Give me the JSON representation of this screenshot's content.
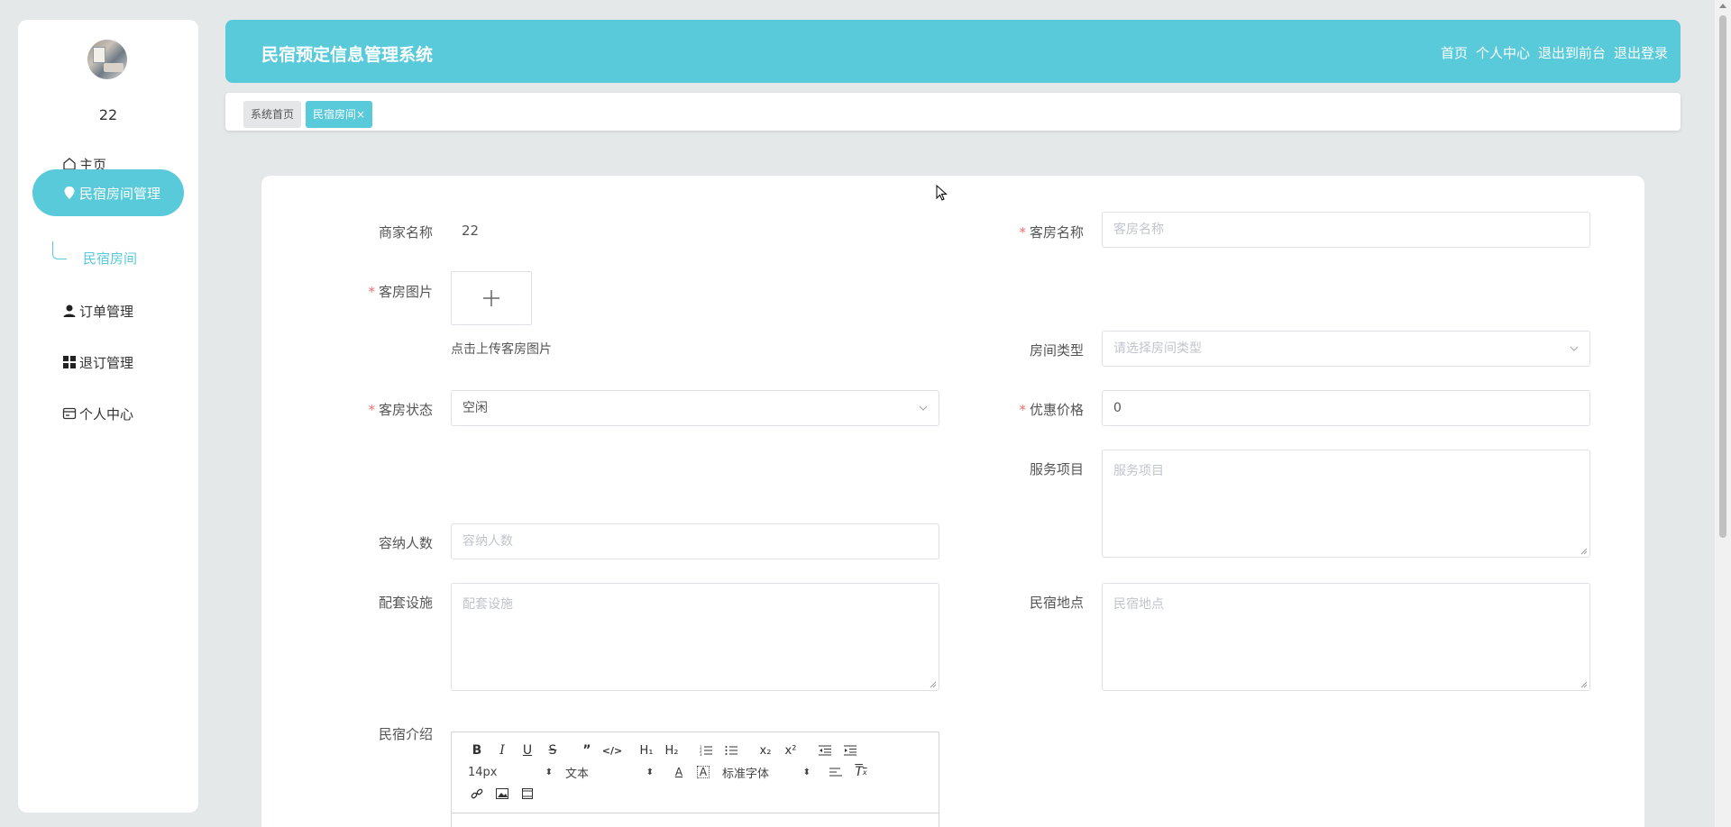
{
  "user": {
    "name": "22"
  },
  "sidebar": {
    "items": [
      {
        "label": "主页",
        "icon": "home-icon"
      },
      {
        "label": "民宿房间管理",
        "icon": "location-icon"
      },
      {
        "label": "订单管理",
        "icon": "user-icon"
      },
      {
        "label": "退订管理",
        "icon": "grid-icon"
      },
      {
        "label": "个人中心",
        "icon": "card-icon"
      }
    ],
    "submenu": {
      "label": "民宿房间"
    }
  },
  "header": {
    "title": "民宿预定信息管理系统",
    "nav": [
      "首页",
      "个人中心",
      "退出到前台",
      "退出登录"
    ]
  },
  "tabs": [
    {
      "label": "系统首页"
    },
    {
      "label": "民宿房间×"
    }
  ],
  "form": {
    "merchant_name": {
      "label": "商家名称",
      "value": "22"
    },
    "room_name": {
      "label": "客房名称",
      "placeholder": "客房名称"
    },
    "room_image": {
      "label": "客房图片",
      "hint": "点击上传客房图片"
    },
    "room_type": {
      "label": "房间类型",
      "placeholder": "请选择房间类型"
    },
    "room_status": {
      "label": "客房状态",
      "value": "空闲"
    },
    "discount_price": {
      "label": "优惠价格",
      "value": "0"
    },
    "service_items": {
      "label": "服务项目",
      "placeholder": "服务项目"
    },
    "capacity": {
      "label": "容纳人数",
      "placeholder": "容纳人数"
    },
    "facilities": {
      "label": "配套设施",
      "placeholder": "配套设施"
    },
    "location": {
      "label": "民宿地点",
      "placeholder": "民宿地点"
    },
    "intro": {
      "label": "民宿介绍"
    }
  },
  "editor": {
    "font_size": "14px",
    "paragraph": "文本",
    "font_family": "标准字体"
  },
  "colors": {
    "accent": "#58cad9",
    "required": "#f56c6c"
  }
}
